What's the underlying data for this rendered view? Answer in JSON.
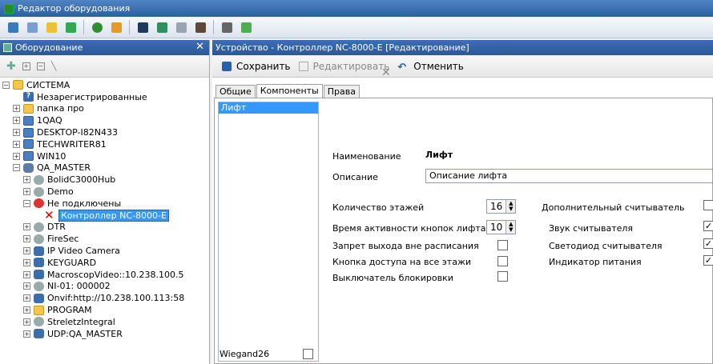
{
  "window": {
    "title": "Редактор оборудования"
  },
  "left": {
    "title": "Оборудование",
    "close": "✕",
    "tree": [
      {
        "label": "СИСТЕМА",
        "level": 0,
        "exp": "−",
        "icon": "folder"
      },
      {
        "label": "Незарегистрированные",
        "level": 1,
        "exp": "",
        "icon": "q"
      },
      {
        "label": "папка про",
        "level": 1,
        "exp": "+",
        "icon": "folder"
      },
      {
        "label": "1QAQ",
        "level": 1,
        "exp": "+",
        "icon": "pc"
      },
      {
        "label": "DESKTOP-I82N433",
        "level": 1,
        "exp": "+",
        "icon": "pc"
      },
      {
        "label": "TECHWRITER81",
        "level": 1,
        "exp": "+",
        "icon": "pc"
      },
      {
        "label": "WIN10",
        "level": 1,
        "exp": "+",
        "icon": "pc"
      },
      {
        "label": "QA_MASTER",
        "level": 1,
        "exp": "−",
        "icon": "db"
      },
      {
        "label": "BolidC3000Hub",
        "level": 2,
        "exp": "+",
        "icon": "dev"
      },
      {
        "label": "Demo",
        "level": 2,
        "exp": "+",
        "icon": "dev"
      },
      {
        "label": "Не подключены",
        "level": 2,
        "exp": "−",
        "icon": "err"
      },
      {
        "label": "Контроллер NC-8000-E",
        "level": 3,
        "exp": "",
        "icon": "cross",
        "selected": true
      },
      {
        "label": "DTR",
        "level": 2,
        "exp": "+",
        "icon": "dev"
      },
      {
        "label": "FireSec",
        "level": 2,
        "exp": "+",
        "icon": "dev"
      },
      {
        "label": "IP Video Camera",
        "level": 2,
        "exp": "+",
        "icon": "cam"
      },
      {
        "label": "KEYGUARD",
        "level": 2,
        "exp": "+",
        "icon": "cam"
      },
      {
        "label": "MacroscopVideo::10.238.100.5",
        "level": 2,
        "exp": "+",
        "icon": "cam"
      },
      {
        "label": "NI-01: 000002",
        "level": 2,
        "exp": "+",
        "icon": "dev"
      },
      {
        "label": "Onvif:http://10.238.100.113:58",
        "level": 2,
        "exp": "+",
        "icon": "cam"
      },
      {
        "label": "PROGRAM",
        "level": 2,
        "exp": "+",
        "icon": "folder"
      },
      {
        "label": "StreletzIntegral",
        "level": 2,
        "exp": "+",
        "icon": "dev"
      },
      {
        "label": "UDP:QA_MASTER",
        "level": 2,
        "exp": "+",
        "icon": "cam"
      }
    ]
  },
  "right": {
    "title": "Устройство - Контроллер NC-8000-E [Редактирование]",
    "save": "Сохранить",
    "edit": "Редактировать",
    "cancel": "Отменить",
    "tabs": [
      "Общие",
      "Компоненты",
      "Права"
    ],
    "component_item": "Лифт",
    "wiegand": "Wiegand26",
    "name_label": "Наименование",
    "name_value": "Лифт",
    "desc_label": "Описание",
    "desc_value": "Описание лифта",
    "floors_label": "Количество этажей",
    "floors_value": "16",
    "active_label": "Время активности кнопок лифта, с",
    "active_value": "10",
    "deny_label": "Запрет выхода вне расписания",
    "allfloors_label": "Кнопка доступа на все этажи",
    "block_label": "Выключатель блокировки",
    "extra_label": "Дополнительный считыватель",
    "sound_label": "Звук считывателя",
    "led_label": "Светодиод считывателя",
    "power_label": "Индикатор питания"
  }
}
